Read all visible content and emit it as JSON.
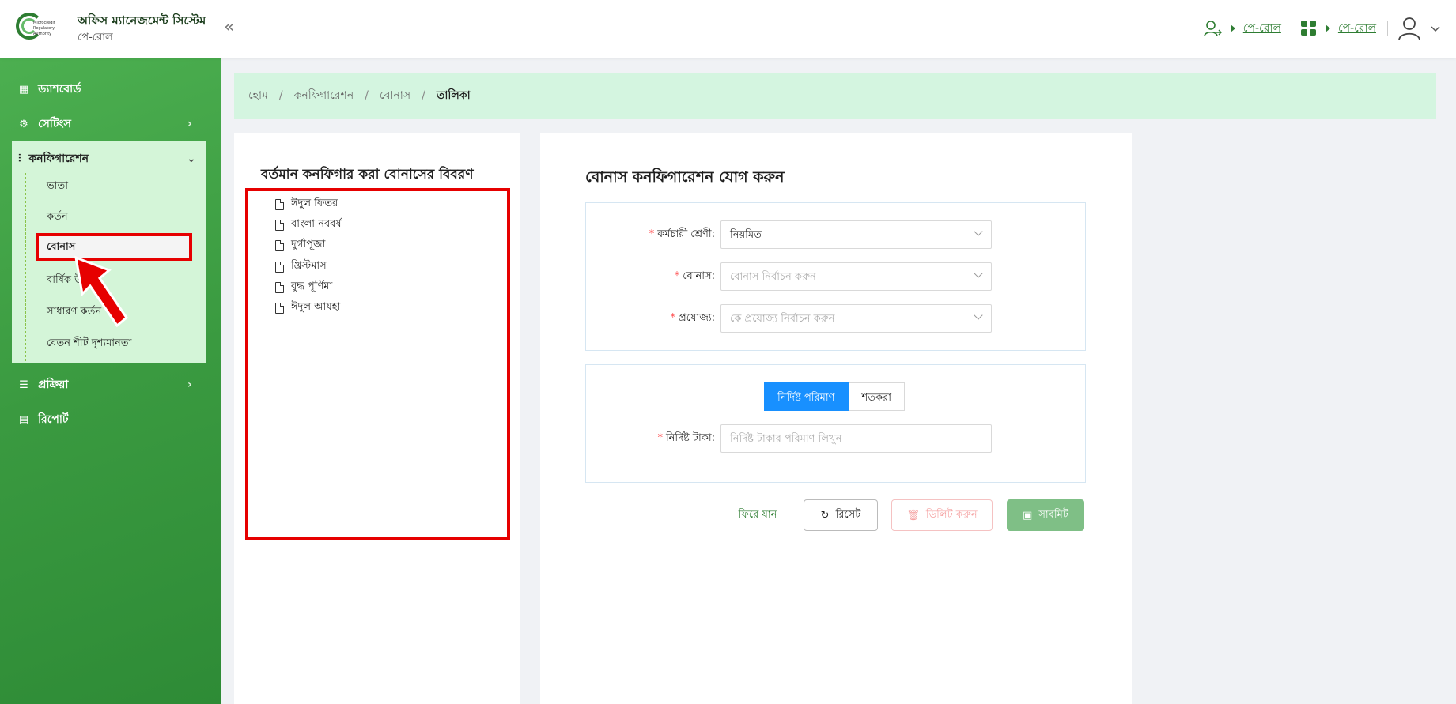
{
  "header": {
    "logo_text": "Microcredit Regulatory Authority",
    "app_title": "অফিস ম্যানেজমেন্ট সিস্টেম",
    "app_subtitle": "পে-রোল",
    "collapse_icon": "«",
    "module_link_1": "পে-রোল",
    "module_link_2": "পে-রোল"
  },
  "sidebar": {
    "items": [
      {
        "label": "ড্যাশবোর্ড",
        "icon": "dashboard-icon"
      },
      {
        "label": "সেটিংস",
        "icon": "gear-icon"
      },
      {
        "label": "কনফিগারেশন",
        "icon": "sliders-icon"
      },
      {
        "label": "প্রক্রিয়া",
        "icon": "process-icon"
      },
      {
        "label": "রিপোর্ট",
        "icon": "report-icon"
      }
    ],
    "sub_items": [
      "ভাতা",
      "কর্তন",
      "বোনাস",
      "বার্ষিক উ",
      "সাধারণ কর্তন",
      "বেতন শীট দৃশ্যমানতা"
    ]
  },
  "breadcrumb": [
    "হোম",
    "কনফিগারেশন",
    "বোনাস",
    "তালিকা"
  ],
  "left_panel": {
    "title": "বর্তমান কনফিগার করা বোনাসের বিবরণ",
    "items": [
      "ঈদুল ফিতর",
      "বাংলা নববর্ষ",
      "দুর্গাপূজা",
      "খ্রিস্টমাস",
      "বুদ্ধ পূর্ণিমা",
      "ঈদুল আযহা"
    ]
  },
  "form": {
    "title": "বোনাস কনফিগারেশন যোগ করুন",
    "employee_class_label": "কর্মচারী শ্রেণী:",
    "employee_class_value": "নিয়মিত",
    "bonus_label": "বোনাস:",
    "bonus_placeholder": "বোনাস নির্বাচন করুন",
    "applicable_label": "প্রযোজ্য:",
    "applicable_placeholder": "কে প্রযোজ্য নির্বাচন করুন",
    "mode_fixed": "নির্দিষ্ট পরিমাণ",
    "mode_percent": "শতকরা",
    "amount_label": "নির্দিষ্ট টাকা:",
    "amount_placeholder": "নির্দিষ্ট টাকার পরিমাণ লিখুন",
    "required_mark": "*"
  },
  "buttons": {
    "back": "ফিরে যান",
    "reset": "রিসেট",
    "delete": "ডিলিট করুন",
    "submit": "সাবমিট"
  },
  "colors": {
    "primary_green": "#3a9a40",
    "highlight_red": "#e60000",
    "segment_blue": "#1890ff",
    "breadcrumb_bg": "#d4f5e0"
  }
}
